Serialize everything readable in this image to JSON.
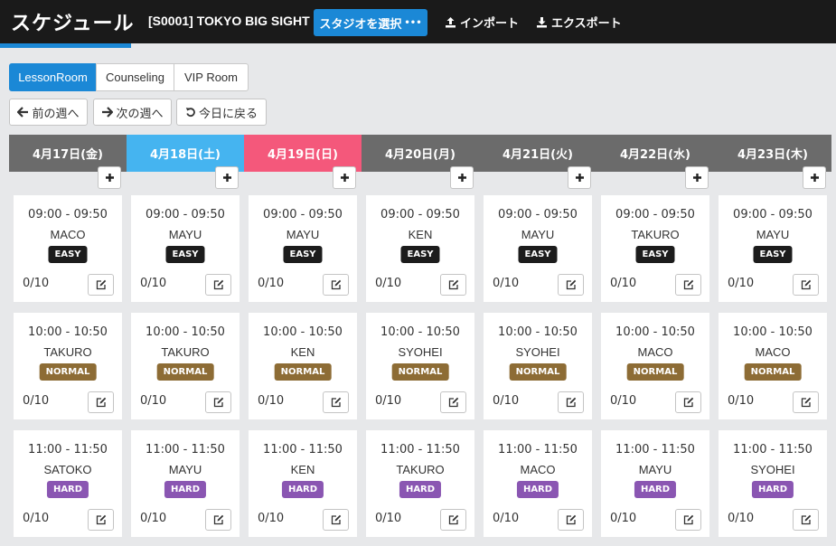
{
  "header": {
    "title": "スケジュール",
    "studio": "[S0001] TOKYO BIG SIGHT",
    "studio_button": "スタジオを選択",
    "import": "インポート",
    "export": "エクスポート"
  },
  "tabs": [
    {
      "label": "LessonRoom",
      "active": true
    },
    {
      "label": "Counseling",
      "active": false
    },
    {
      "label": "VIP Room",
      "active": false
    }
  ],
  "week_nav": {
    "prev": "前の週へ",
    "next": "次の週へ",
    "today": "今日に戻る"
  },
  "colors": {
    "accent": "#1b88d6",
    "weekday": "#6b6b6b",
    "saturday": "#45b4f0",
    "sunday": "#f4587b",
    "easy": "#1c1c1c",
    "normal": "#8d6c35",
    "hard": "#8a56b2"
  },
  "days": [
    {
      "label": "4月17日(金)",
      "kind": "weekday"
    },
    {
      "label": "4月18日(土)",
      "kind": "saturday"
    },
    {
      "label": "4月19日(日)",
      "kind": "sunday"
    },
    {
      "label": "4月20日(月)",
      "kind": "weekday"
    },
    {
      "label": "4月21日(火)",
      "kind": "weekday"
    },
    {
      "label": "4月22日(水)",
      "kind": "weekday"
    },
    {
      "label": "4月23日(木)",
      "kind": "weekday"
    }
  ],
  "slots": [
    {
      "time": "09:00 - 09:50",
      "level": "EASY",
      "level_key": "easy",
      "instructors": [
        "MACO",
        "MAYU",
        "MAYU",
        "KEN",
        "MAYU",
        "TAKURO",
        "MAYU"
      ],
      "capacity": [
        "0/10",
        "0/10",
        "0/10",
        "0/10",
        "0/10",
        "0/10",
        "0/10"
      ]
    },
    {
      "time": "10:00 - 10:50",
      "level": "NORMAL",
      "level_key": "normal",
      "instructors": [
        "TAKURO",
        "TAKURO",
        "KEN",
        "SYOHEI",
        "SYOHEI",
        "MACO",
        "MACO"
      ],
      "capacity": [
        "0/10",
        "0/10",
        "0/10",
        "0/10",
        "0/10",
        "0/10",
        "0/10"
      ]
    },
    {
      "time": "11:00 - 11:50",
      "level": "HARD",
      "level_key": "hard",
      "instructors": [
        "SATOKO",
        "MAYU",
        "KEN",
        "TAKURO",
        "MACO",
        "MAYU",
        "SYOHEI"
      ],
      "capacity": [
        "0/10",
        "0/10",
        "0/10",
        "0/10",
        "0/10",
        "0/10",
        "0/10"
      ]
    }
  ]
}
